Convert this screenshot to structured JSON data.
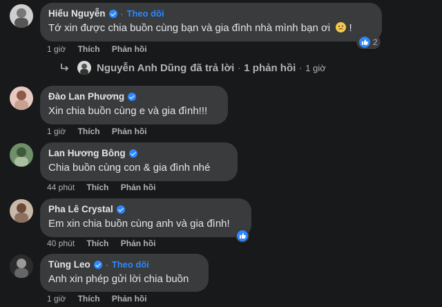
{
  "comments": [
    {
      "name": "Hiếu Nguyễn",
      "follow": "Theo dõi",
      "text": "Tớ xin được chia buồn cùng bạn và gia đình nhà mình bạn ơi",
      "text_suffix": "!",
      "time": "1 giờ",
      "like": "Thích",
      "reply": "Phản hồi",
      "reaction_count": "2"
    },
    {
      "name": "Đào Lan Phương",
      "text": "Xin chia buồn cùng e và gia đình!!!",
      "time": "1 giờ",
      "like": "Thích",
      "reply": "Phản hồi"
    },
    {
      "name": "Lan Hương Bông",
      "text": "Chia buồn cùng con & gia đình nhé",
      "time": "44 phút",
      "like": "Thích",
      "reply": "Phản hồi"
    },
    {
      "name": "Pha Lê Crystal",
      "text": "Em xin chia buồn cùng anh và gia đình!",
      "time": "40 phút",
      "like": "Thích",
      "reply": "Phản hồi"
    },
    {
      "name": "Tùng Leo",
      "follow": "Theo dõi",
      "text": "Anh xin phép gửi lời chia buồn",
      "time": "1 giờ",
      "like": "Thích",
      "reply": "Phản hồi"
    }
  ],
  "reply_thread": {
    "name": "Nguyễn Anh Dũng",
    "text": "đã trả lời",
    "count": "1 phản hồi",
    "time": "1 giờ"
  },
  "colors": {
    "background": "#18191a",
    "bubble": "#3a3b3c",
    "accent": "#2d88ff",
    "secondary_text": "#b0b3b8"
  }
}
